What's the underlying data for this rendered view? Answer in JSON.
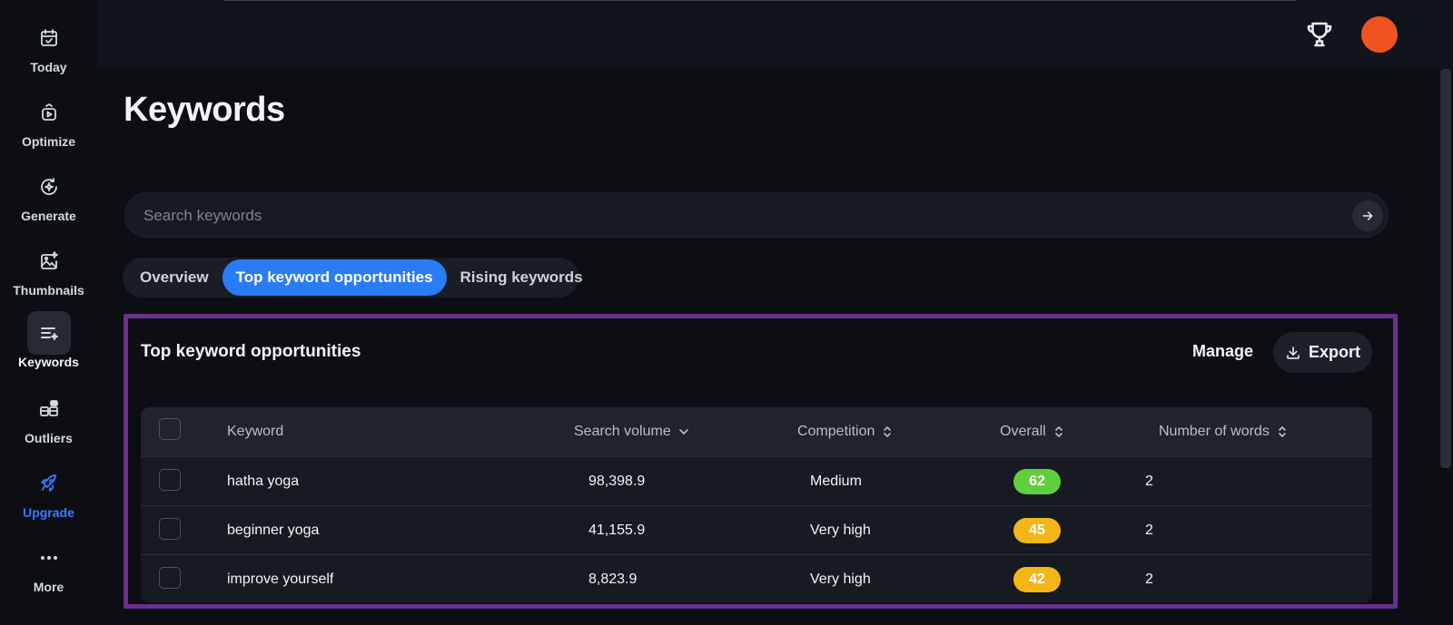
{
  "sidebar": {
    "items": [
      {
        "label": "Today",
        "icon": "calendar-check-icon"
      },
      {
        "label": "Optimize",
        "icon": "video-optimize-icon"
      },
      {
        "label": "Generate",
        "icon": "sparkle-refresh-icon"
      },
      {
        "label": "Thumbnails",
        "icon": "image-sparkle-icon"
      },
      {
        "label": "Keywords",
        "icon": "list-sparkle-icon"
      },
      {
        "label": "Outliers",
        "icon": "outliers-icon"
      },
      {
        "label": "Upgrade",
        "icon": "rocket-icon"
      },
      {
        "label": "More",
        "icon": "ellipsis-icon"
      }
    ]
  },
  "header": {
    "trophy_icon": "trophy-icon",
    "avatar_color": "#f0531f"
  },
  "page": {
    "title": "Keywords"
  },
  "search": {
    "placeholder": "Search keywords"
  },
  "tabs": [
    {
      "label": "Overview",
      "active": false
    },
    {
      "label": "Top keyword opportunities",
      "active": true
    },
    {
      "label": "Rising keywords",
      "active": false
    }
  ],
  "card": {
    "title": "Top keyword opportunities",
    "manage_label": "Manage",
    "export_label": "Export"
  },
  "table": {
    "columns": [
      "Keyword",
      "Search volume",
      "Competition",
      "Overall",
      "Number of words"
    ],
    "rows": [
      {
        "keyword": "hatha yoga",
        "volume": "98,398.9",
        "competition": "Medium",
        "overall": "62",
        "overall_color": "#5fcf3c",
        "words": "2"
      },
      {
        "keyword": "beginner yoga",
        "volume": "41,155.9",
        "competition": "Very high",
        "overall": "45",
        "overall_color": "#f2b619",
        "words": "2"
      },
      {
        "keyword": "improve yourself",
        "volume": "8,823.9",
        "competition": "Very high",
        "overall": "42",
        "overall_color": "#f2b619",
        "words": "2"
      }
    ]
  },
  "colors": {
    "accent": "#2a7cf6",
    "highlight_border": "#6a2f8f"
  }
}
